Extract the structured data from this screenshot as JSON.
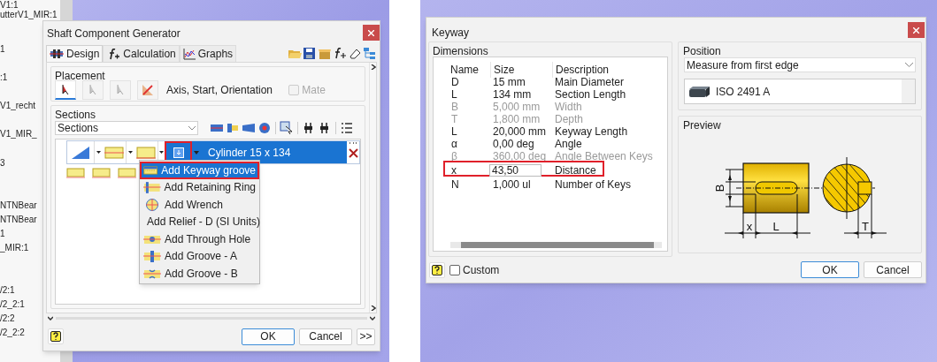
{
  "background_tree": {
    "items": [
      "V1:1",
      "utterV1_MIR:1",
      "1",
      ":1",
      "V1_recht",
      "V1_MIR_",
      "3",
      "NTNBear",
      "NTNBear",
      "1",
      "_MIR:1",
      "/2:1",
      "/2_2:1",
      "/2:2",
      "/2_2:2"
    ]
  },
  "generator": {
    "title": "Shaft Component Generator",
    "tabs": [
      {
        "label": "Design",
        "selected": true,
        "kind": "design"
      },
      {
        "label": "Calculation",
        "selected": false,
        "kind": "calculation"
      },
      {
        "label": "Graphs",
        "selected": false,
        "kind": "graphs"
      }
    ],
    "placement": {
      "legend": "Placement",
      "hint": "Axis, Start, Orientation",
      "tools": [
        {
          "kind": "pointer",
          "selected": true
        },
        {
          "kind": "pointer",
          "selected": false
        },
        {
          "kind": "pointer",
          "selected": false
        },
        {
          "kind": "cross",
          "selected": false
        }
      ],
      "mate": {
        "label": "Mate",
        "checked": false,
        "disabled": true
      }
    },
    "sections": {
      "legend": "Sections",
      "dropdown": "Sections",
      "segment_label": "Cylinder 15 x 134",
      "feature_button_highlighted": true
    },
    "menu": [
      {
        "label": "Add Keyway groove",
        "selected": true,
        "highlighted": true
      },
      {
        "label": "Add Retaining Ring",
        "selected": false,
        "highlighted": false
      },
      {
        "label": "Add Wrench",
        "selected": false,
        "highlighted": false
      },
      {
        "label": "Add Relief - D (SI Units)",
        "selected": false,
        "highlighted": false
      },
      {
        "label": "Add Through Hole",
        "selected": false,
        "highlighted": false
      },
      {
        "label": "Add Groove - A",
        "selected": false,
        "highlighted": false
      },
      {
        "label": "Add Groove - B",
        "selected": false,
        "highlighted": false
      }
    ],
    "buttons": [
      {
        "label": "OK",
        "default": true
      },
      {
        "label": "Cancel",
        "default": false
      },
      {
        "label": ">>",
        "default": false
      }
    ]
  },
  "keyway": {
    "title": "Keyway",
    "dimensions": {
      "legend": "Dimensions",
      "columns": [
        "Name",
        "Size",
        "Description"
      ],
      "rows": [
        {
          "name": "D",
          "size": "15 mm",
          "description": "Main Diameter",
          "disabled": false,
          "editing": false,
          "highlighted": false
        },
        {
          "name": "L",
          "size": "134 mm",
          "description": "Section Length",
          "disabled": false,
          "editing": false,
          "highlighted": false
        },
        {
          "name": "B",
          "size": "5,000 mm",
          "description": "Width",
          "disabled": true,
          "editing": false,
          "highlighted": false
        },
        {
          "name": "T",
          "size": "1,800 mm",
          "description": "Depth",
          "disabled": true,
          "editing": false,
          "highlighted": false
        },
        {
          "name": "L",
          "size": "20,000 mm",
          "description": "Keyway Length",
          "disabled": false,
          "editing": false,
          "highlighted": false
        },
        {
          "name": "α",
          "size": "0,00 deg",
          "description": "Angle",
          "disabled": false,
          "editing": false,
          "highlighted": false
        },
        {
          "name": "β",
          "size": "360,00 deg",
          "description": "Angle Between Keys",
          "disabled": true,
          "editing": false,
          "highlighted": false
        },
        {
          "name": "x",
          "size": "43,50",
          "description": "Distance",
          "disabled": false,
          "editing": true,
          "highlighted": true
        },
        {
          "name": "N",
          "size": "1,000 ul",
          "description": "Number of Keys",
          "disabled": false,
          "editing": false,
          "highlighted": false
        }
      ]
    },
    "position": {
      "legend": "Position",
      "dropdown": "Measure from first edge",
      "key_standard": "ISO 2491 A"
    },
    "preview": {
      "legend": "Preview",
      "labels": [
        "B",
        "x",
        "L",
        "T"
      ]
    },
    "custom": {
      "label": "Custom",
      "checked": false
    },
    "buttons": [
      {
        "label": "OK",
        "default": true
      },
      {
        "label": "Cancel",
        "default": false
      }
    ]
  }
}
